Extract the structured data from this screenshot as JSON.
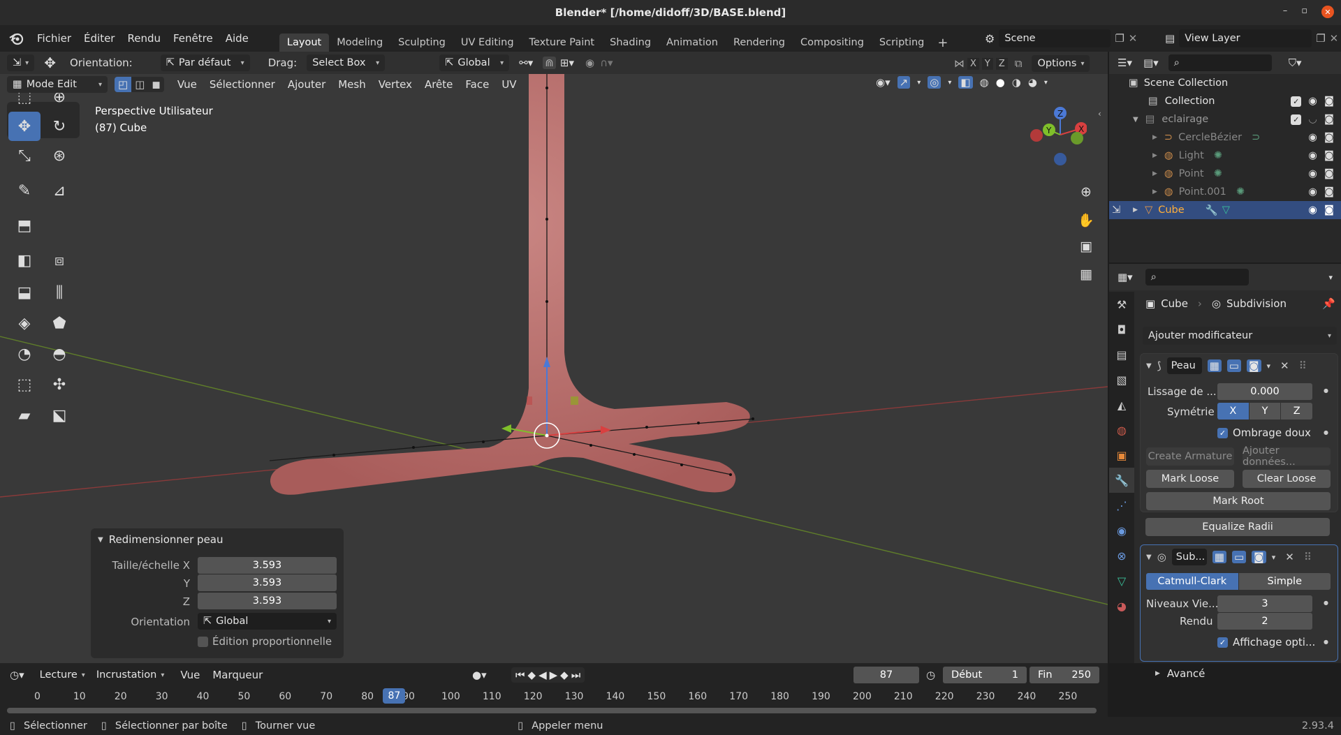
{
  "window": {
    "title": "Blender* [/home/didoff/3D/BASE.blend]",
    "btn_min": "–",
    "btn_max": "▫",
    "btn_close": "✕"
  },
  "menu": {
    "items": [
      "Fichier",
      "Éditer",
      "Rendu",
      "Fenêtre",
      "Aide"
    ],
    "workspaces": [
      "Layout",
      "Modeling",
      "Sculpting",
      "UV Editing",
      "Texture Paint",
      "Shading",
      "Animation",
      "Rendering",
      "Compositing",
      "Scripting"
    ],
    "add": "+",
    "scene": "Scene",
    "view_layer": "View Layer"
  },
  "tool_header": {
    "orientation_label": "Orientation:",
    "orientation_value": "Par défaut",
    "drag_label": "Drag:",
    "drag_value": "Select Box",
    "transform_orientation": "Global",
    "axis_x": "X",
    "axis_y": "Y",
    "axis_z": "Z",
    "options": "Options"
  },
  "viewport_header": {
    "mode": "Mode Edit",
    "menus": [
      "Vue",
      "Sélectionner",
      "Ajouter",
      "Mesh",
      "Vertex",
      "Arête",
      "Face",
      "UV"
    ]
  },
  "viewport": {
    "view_name": "Perspective Utilisateur",
    "object_info": "(87) Cube",
    "gizmo": {
      "z": "Z",
      "y": "Y",
      "x": "X"
    },
    "colors": {
      "mesh": "#c2706e",
      "x_axis": "#9a3a3a",
      "y_axis": "#6a8a2a",
      "active_tool": "#4772b3"
    }
  },
  "operator_panel": {
    "title": "Redimensionner peau",
    "labels": {
      "x": "Taille/échelle X",
      "y": "Y",
      "z": "Z",
      "orientation": "Orientation",
      "prop_edit": "Édition proportionnelle"
    },
    "values": {
      "x": "3.593",
      "y": "3.593",
      "z": "3.593",
      "orientation": "Global"
    }
  },
  "outliner": {
    "root": "Scene Collection",
    "items": [
      {
        "name": "Collection",
        "indent": 0
      },
      {
        "name": "eclairage",
        "indent": 0
      },
      {
        "name": "CercleBézier",
        "indent": 1
      },
      {
        "name": "Light",
        "indent": 1
      },
      {
        "name": "Point",
        "indent": 1
      },
      {
        "name": "Point.001",
        "indent": 1
      },
      {
        "name": "Cube",
        "indent": 0
      }
    ]
  },
  "properties": {
    "breadcrumb_object": "Cube",
    "breadcrumb_modifier": "Subdivision",
    "add_modifier": "Ajouter modificateur",
    "skin": {
      "name": "Peau",
      "branch_smoothing_label": "Lissage de ...",
      "branch_smoothing_value": "0.000",
      "symmetry_label": "Symétrie",
      "symmetry": [
        "X",
        "Y",
        "Z"
      ],
      "smooth_shading": "Ombrage doux",
      "create_armature": "Create Armature",
      "add_data": "Ajouter données...",
      "mark_loose": "Mark Loose",
      "clear_loose": "Clear Loose",
      "mark_root": "Mark Root",
      "equalize_radii": "Equalize Radii"
    },
    "subdivision": {
      "name": "Sub...",
      "catmull": "Catmull-Clark",
      "simple": "Simple",
      "levels_label": "Niveaux Vie...",
      "levels_value": "3",
      "render_label": "Rendu",
      "render_value": "2",
      "optimal_display": "Affichage opti...",
      "advanced": "Avancé"
    }
  },
  "timeline": {
    "menus": [
      "Lecture",
      "Incrustation",
      "Vue",
      "Marqueur"
    ],
    "current_frame": "87",
    "start_label": "Début",
    "start_value": "1",
    "end_label": "Fin",
    "end_value": "250",
    "ticks": [
      "0",
      "10",
      "20",
      "30",
      "40",
      "50",
      "60",
      "70",
      "80",
      "90",
      "100",
      "110",
      "120",
      "130",
      "140",
      "150",
      "160",
      "170",
      "180",
      "190",
      "200",
      "210",
      "220",
      "230",
      "240",
      "250"
    ]
  },
  "status": {
    "select": "Sélectionner",
    "box_select": "Sélectionner par boîte",
    "rotate_view": "Tourner vue",
    "call_menu": "Appeler menu",
    "version": "2.93.4"
  }
}
